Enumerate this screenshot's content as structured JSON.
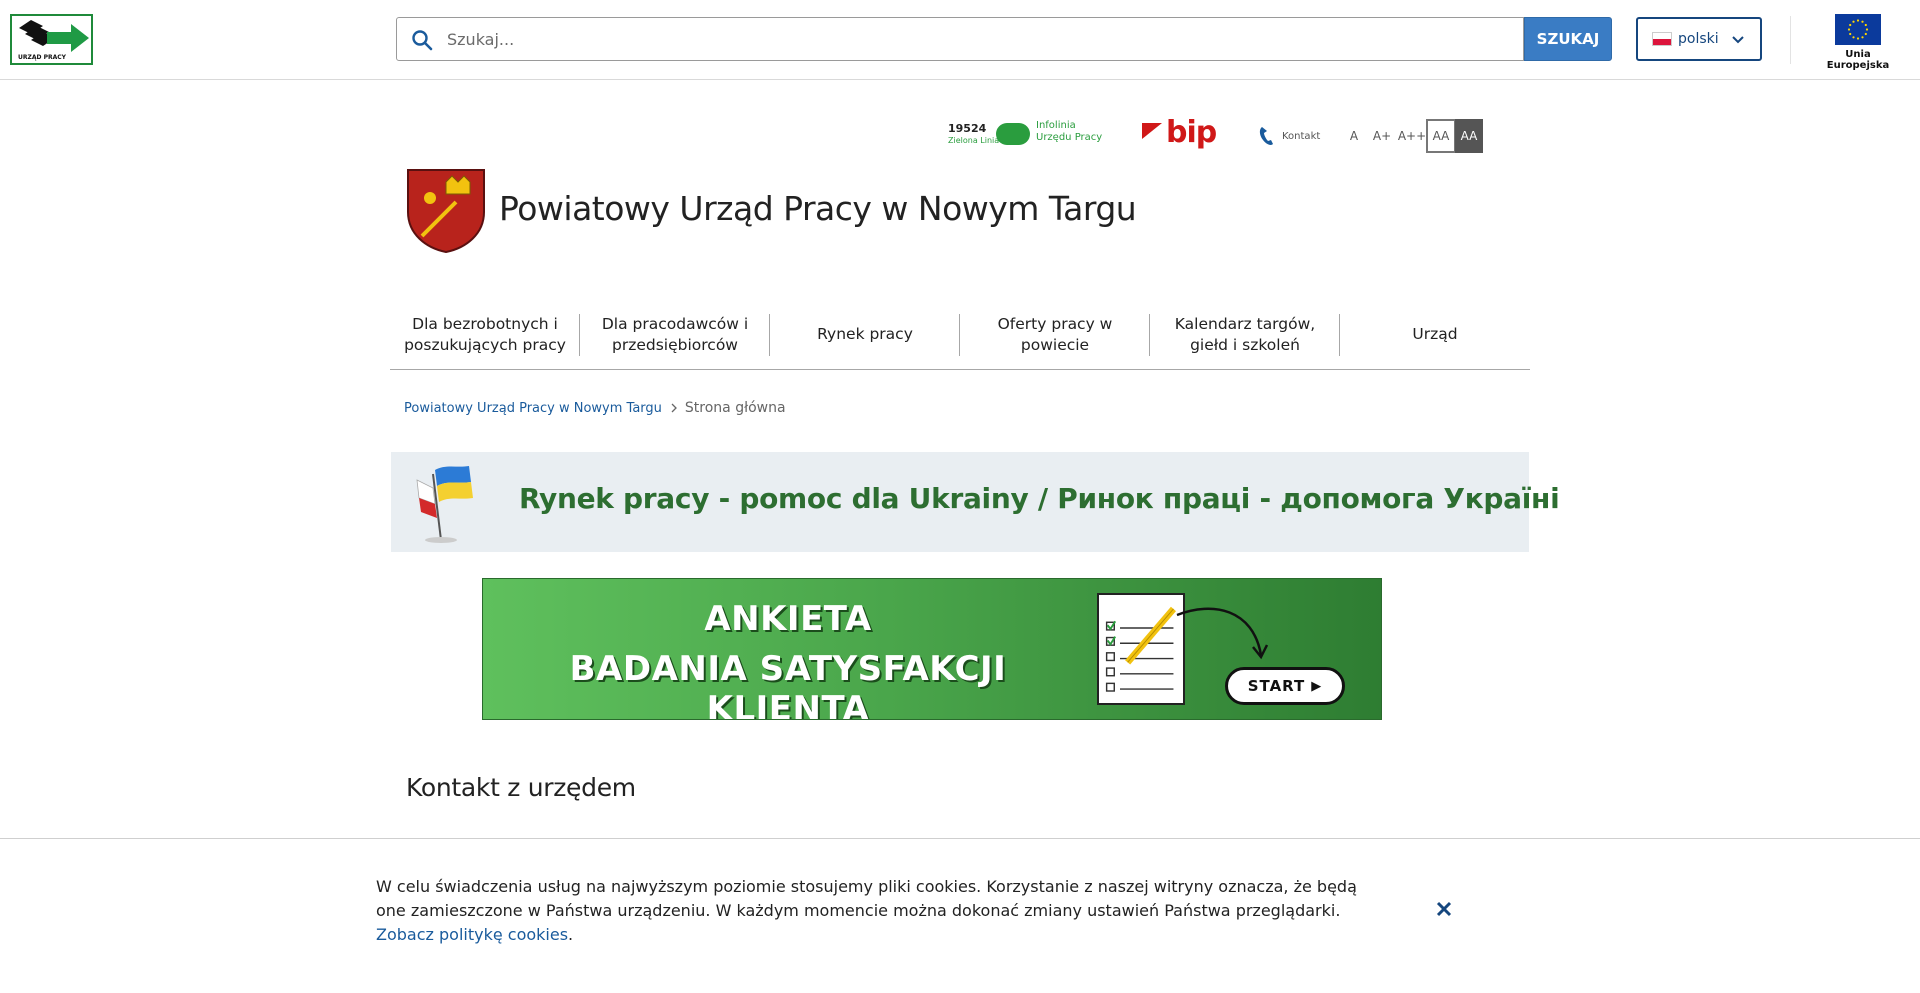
{
  "header": {
    "logo_text": "URZĄD PRACY",
    "search_placeholder": "Szukaj...",
    "search_button": "SZUKAJ",
    "language": "polski",
    "eu_label": "Unia Europejska"
  },
  "utility": {
    "infolinia_number": "19524",
    "infolinia_sub": "Zielona Linia",
    "infolinia_text": "Infolinia Urzędu Pracy",
    "bip_label": "bip",
    "kontakt_label": "Kontakt",
    "font_small": "A",
    "font_medium": "A+",
    "font_large": "A++",
    "contrast_normal": "AA",
    "contrast_high": "AA"
  },
  "site": {
    "title": "Powiatowy Urząd Pracy w Nowym Targu"
  },
  "nav": {
    "items": [
      {
        "label": "Dla bezrobotnych i poszukujących pracy"
      },
      {
        "label": "Dla pracodawców i przedsiębiorców"
      },
      {
        "label": "Rynek pracy"
      },
      {
        "label": "Oferty pracy w powiecie"
      },
      {
        "label": "Kalendarz targów, giełd i szkoleń"
      },
      {
        "label": "Urząd"
      }
    ]
  },
  "breadcrumb": {
    "home": "Powiatowy Urząd Pracy w Nowym Targu",
    "current": "Strona główna"
  },
  "banners": {
    "ukraine": "Rynek pracy - pomoc dla Ukrainy / Ринок праці - допомога Україні",
    "survey_line1": "ANKIETA",
    "survey_line2": "BADANIA SATYSFAKCJI KLIENTA",
    "survey_start": "START"
  },
  "main": {
    "section_title": "Kontakt z urzędem"
  },
  "cookie": {
    "text": "W celu świadczenia usług na najwyższym poziomie stosujemy pliki cookies. Korzystanie z naszej witryny oznacza, że będą one zamieszczone w Państwa urządzeniu. W każdym momencie można dokonać zmiany ustawień Państwa przeglądarki.",
    "link": "Zobacz politykę cookies"
  },
  "colors": {
    "primary_blue": "#3a7cc4",
    "dark_blue": "#15467e",
    "link_blue": "#1a5b9c",
    "green": "#2d6e31",
    "bip_red": "#d01818"
  }
}
